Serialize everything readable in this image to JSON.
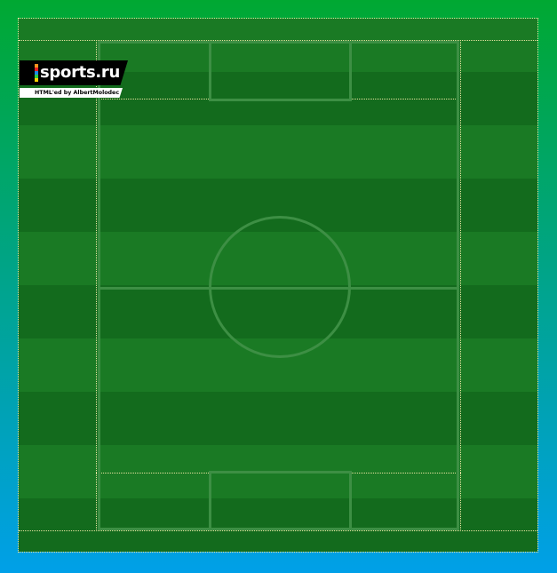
{
  "logo": {
    "brand": "sports.ru",
    "credit": "HTML'ed by AlbertMolodec",
    "mark_colors": [
      "#f7931e",
      "#e31e24",
      "#1e88e5",
      "#2ecc40",
      "#ffd400"
    ]
  },
  "field": {
    "stripe_light": "#1a7a24",
    "stripe_dark": "#136b1d",
    "line_color": "#3d8f44",
    "guide_color": "#e8e2a0"
  }
}
